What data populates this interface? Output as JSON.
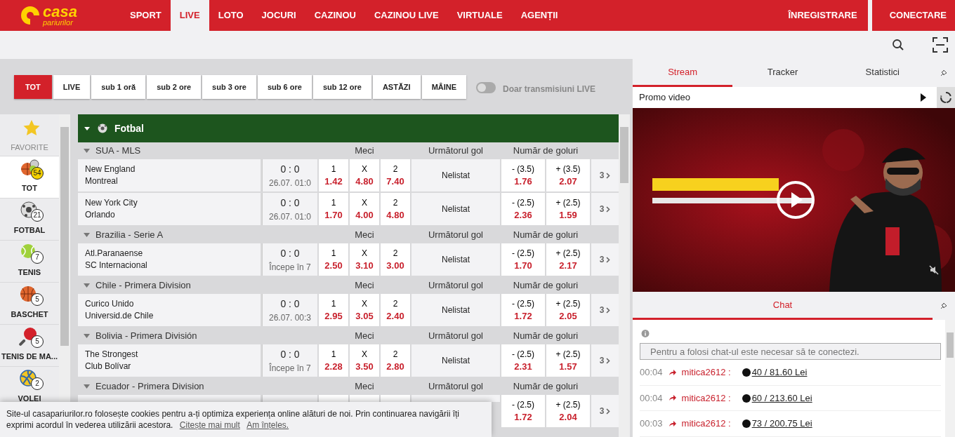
{
  "header": {
    "logo": {
      "main": "casa",
      "sub": "pariurilor"
    },
    "nav": [
      {
        "label": "SPORT",
        "selected": false
      },
      {
        "label": "LIVE",
        "selected": true
      },
      {
        "label": "LOTO",
        "selected": false
      },
      {
        "label": "JOCURI",
        "selected": false
      },
      {
        "label": "CAZINOU",
        "selected": false
      },
      {
        "label": "CAZINOU LIVE",
        "selected": false
      },
      {
        "label": "VIRTUALE",
        "selected": false
      },
      {
        "label": "AGENȚII",
        "selected": false
      }
    ],
    "actions": [
      "ÎNREGISTRARE",
      "CONECTARE"
    ]
  },
  "filters": {
    "buttons": [
      {
        "label": "TOT",
        "selected": true
      },
      {
        "label": "LIVE",
        "selected": false
      },
      {
        "label": "sub 1 oră",
        "selected": false
      },
      {
        "label": "sub 2 ore",
        "selected": false
      },
      {
        "label": "sub 3 ore",
        "selected": false
      },
      {
        "label": "sub 6 ore",
        "selected": false
      },
      {
        "label": "sub 12 ore",
        "selected": false
      },
      {
        "label": "ASTĂZI",
        "selected": false
      },
      {
        "label": "MÂINE",
        "selected": false
      }
    ],
    "toggle": {
      "label": "Doar transmisiuni LIVE",
      "on": false
    }
  },
  "sports": [
    {
      "kind": "favorite",
      "label": "FAVORITE",
      "selected": false
    },
    {
      "kind": "all",
      "label": "TOT",
      "count": "54",
      "selected": true
    },
    {
      "kind": "football",
      "label": "FOTBAL",
      "count": "21",
      "selected": false
    },
    {
      "kind": "tennis",
      "label": "TENIS",
      "count": "7",
      "selected": false
    },
    {
      "kind": "basketball",
      "label": "BASCHET",
      "count": "5",
      "selected": false
    },
    {
      "kind": "tabletennis",
      "label": "TENIS DE MA...",
      "count": "5",
      "selected": false
    },
    {
      "kind": "volleyball",
      "label": "VOLEI",
      "count": "2",
      "selected": false
    }
  ],
  "sport_section": {
    "title": "Fotbal",
    "expanded": true,
    "leagues": [
      {
        "name": "SUA - MLS",
        "columns": [
          "Meci",
          "Următorul gol",
          "Număr de goluri"
        ],
        "matches": [
          {
            "home": "New England",
            "away": "Montreal",
            "score": "0 : 0",
            "time": "26.07. 01:0",
            "odds": [
              {
                "label": "1",
                "value": "1.42"
              },
              {
                "label": "X",
                "value": "4.80"
              },
              {
                "label": "2",
                "value": "7.40"
              }
            ],
            "next_goal": "Nelistat",
            "goals": [
              {
                "label": "- (3.5)",
                "value": "1.76"
              },
              {
                "label": "+ (3.5)",
                "value": "2.07"
              }
            ],
            "more": "3"
          },
          {
            "home": "New York City",
            "away": "Orlando",
            "score": "0 : 0",
            "time": "26.07. 01:0",
            "odds": [
              {
                "label": "1",
                "value": "1.70"
              },
              {
                "label": "X",
                "value": "4.00"
              },
              {
                "label": "2",
                "value": "4.80"
              }
            ],
            "next_goal": "Nelistat",
            "goals": [
              {
                "label": "- (2.5)",
                "value": "2.36"
              },
              {
                "label": "+ (2.5)",
                "value": "1.59"
              }
            ],
            "more": "3"
          }
        ]
      },
      {
        "name": "Brazilia - Serie A",
        "columns": [
          "Meci",
          "Următorul gol",
          "Număr de goluri"
        ],
        "matches": [
          {
            "home": "Atl.Paranaense",
            "away": "SC Internacional",
            "score": "0 : 0",
            "time": "Începe în 7",
            "odds": [
              {
                "label": "1",
                "value": "2.50"
              },
              {
                "label": "X",
                "value": "3.10"
              },
              {
                "label": "2",
                "value": "3.00"
              }
            ],
            "next_goal": "Nelistat",
            "goals": [
              {
                "label": "- (2.5)",
                "value": "1.70"
              },
              {
                "label": "+ (2.5)",
                "value": "2.17"
              }
            ],
            "more": "3"
          }
        ]
      },
      {
        "name": "Chile - Primera Division",
        "columns": [
          "Meci",
          "Următorul gol",
          "Număr de goluri"
        ],
        "matches": [
          {
            "home": "Curico Unido",
            "away": "Universid.de Chile",
            "score": "0 : 0",
            "time": "26.07. 00:3",
            "odds": [
              {
                "label": "1",
                "value": "2.95"
              },
              {
                "label": "X",
                "value": "3.05"
              },
              {
                "label": "2",
                "value": "2.40"
              }
            ],
            "next_goal": "Nelistat",
            "goals": [
              {
                "label": "- (2.5)",
                "value": "1.72"
              },
              {
                "label": "+ (2.5)",
                "value": "2.05"
              }
            ],
            "more": "3"
          }
        ]
      },
      {
        "name": "Bolivia - Primera División",
        "columns": [
          "Meci",
          "Următorul gol",
          "Număr de goluri"
        ],
        "matches": [
          {
            "home": "The Strongest",
            "away": "Club Bolívar",
            "score": "0 : 0",
            "time": "Începe în 7",
            "odds": [
              {
                "label": "1",
                "value": "2.28"
              },
              {
                "label": "X",
                "value": "3.50"
              },
              {
                "label": "2",
                "value": "2.80"
              }
            ],
            "next_goal": "Nelistat",
            "goals": [
              {
                "label": "- (2.5)",
                "value": "2.31"
              },
              {
                "label": "+ (2.5)",
                "value": "1.57"
              }
            ],
            "more": "3"
          }
        ]
      },
      {
        "name": "Ecuador - Primera Division",
        "columns": [
          "Meci",
          "Următorul gol",
          "Număr de goluri"
        ],
        "matches": [
          {
            "goals": [
              {
                "label": "- (2.5)",
                "value": "1.72"
              },
              {
                "label": "+ (2.5)",
                "value": "2.04"
              }
            ],
            "more": "3"
          }
        ]
      }
    ]
  },
  "side_panel": {
    "tabs": [
      {
        "label": "Stream",
        "selected": true
      },
      {
        "label": "Tracker",
        "selected": false
      },
      {
        "label": "Statistici",
        "selected": false
      }
    ],
    "stream": {
      "title": "Promo video"
    },
    "chat": {
      "title": "Chat",
      "placeholder": "Pentru a folosi chat-ul este necesar să te conectezi.",
      "messages": [
        {
          "time": "00:04",
          "user": "mitica2612 :",
          "bet": "40 / 81.60 Lei"
        },
        {
          "time": "00:04",
          "user": "mitica2612 :",
          "bet": "60 / 213.60 Lei"
        },
        {
          "time": "00:03",
          "user": "mitica2612 :",
          "bet": "73 / 200.75 Lei"
        }
      ]
    }
  },
  "cookie_banner": {
    "text": "Site-ul casapariurilor.ro folosește cookies pentru a-ți optimiza experiența online alături de noi. Prin continuarea navigării îți exprimi acordul în vederea utilizării acestora.",
    "links": [
      "Citește mai mult",
      "Am înțeles."
    ]
  }
}
